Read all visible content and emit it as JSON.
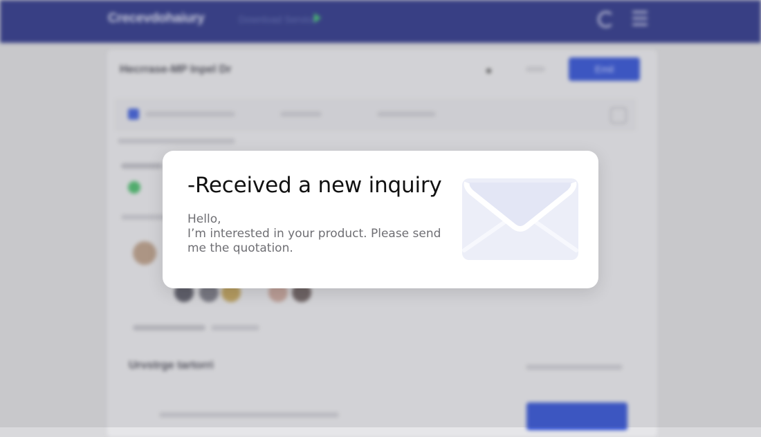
{
  "background": {
    "logo": "Crecevdohaiury",
    "nav_link": "Download Service",
    "page_title": "Hecrrase-MP Inpel Dr",
    "email_button": "Emil",
    "section2_title": "Urvstrge tartorri"
  },
  "modal": {
    "title": "-Received a new inquiry",
    "greeting": "Hello,",
    "line1": "I’m interested in your product. Please send",
    "line2": "me the quotation.",
    "icon": "envelope-icon"
  },
  "colors": {
    "header": "#2a3385",
    "primary_button": "#2f4fd0",
    "status_green": "#49b86a"
  }
}
